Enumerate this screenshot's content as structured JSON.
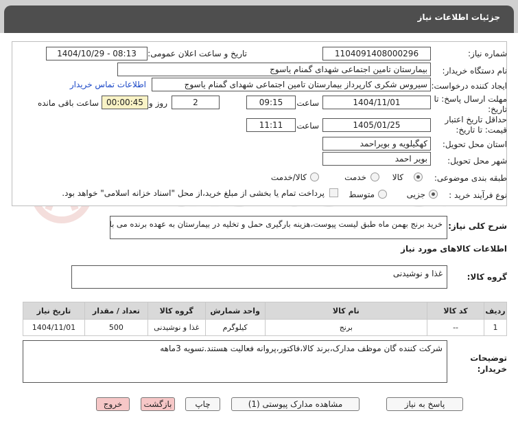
{
  "header": {
    "title": "جزئیات اطلاعات نیاز"
  },
  "form": {
    "need_number_label": "شماره نیاز:",
    "need_number": "1104091408000296",
    "announce_label": "تاریخ و ساعت اعلان عمومی:",
    "announce_value": "1404/10/29 - 08:13",
    "buyer_org_label": "نام دستگاه خریدار:",
    "buyer_org": "بیمارستان تامین اجتماعی شهدای گمنام یاسوج",
    "creator_label": "ایجاد کننده درخواست:",
    "creator": "سیروس شکری کارپرداز بیمارستان تامین اجتماعی شهدای گمنام یاسوج",
    "contact_link": "اطلاعات تماس خریدار",
    "deadline_label_1": "مهلت ارسال پاسخ: تا",
    "deadline_label_2": "تاریخ:",
    "deadline_date": "1404/11/01",
    "time_label": "ساعت",
    "deadline_time": "09:15",
    "days_value": "2",
    "days_label": "روز و",
    "remaining_time": "00:00:45",
    "remaining_label": "ساعت باقی مانده",
    "validity_label_1": "حداقل تاریخ اعتبار",
    "validity_label_2": "قیمت: تا تاریخ:",
    "validity_date": "1405/01/25",
    "validity_time_label": "ساعت",
    "validity_time": "11:11",
    "province_label": "استان محل تحویل:",
    "province": "کهگیلویه و بویراحمد",
    "city_label": "شهر محل تحویل:",
    "city": "بویر احمد",
    "category_label": "طبقه بندی موضوعی:",
    "category_options": [
      "کالا",
      "خدمت",
      "کالا/خدمت"
    ],
    "process_label": "نوع فرآیند خرید :",
    "process_options": [
      "جزیی",
      "متوسط"
    ],
    "payment_note": "پرداخت تمام یا بخشی از مبلغ خرید،از محل \"اسناد خزانه اسلامی\" خواهد بود."
  },
  "description": {
    "label": "شرح کلی نیاز:",
    "text": "خرید برنج بهمن ماه طبق لیست پیوست،هزینه بارگیری حمل و تخلیه در بیمارستان به عهده برنده می باشد"
  },
  "goods": {
    "section_title": "اطلاعات کالاهای مورد نیاز",
    "group_label": "گروه کالا:",
    "group_value": "غذا و نوشیدنی",
    "columns": [
      "ردیف",
      "کد کالا",
      "نام کالا",
      "واحد شمارش",
      "گروه کالا",
      "تعداد / مقدار",
      "تاریخ نیاز"
    ],
    "rows": [
      [
        "1",
        "--",
        "برنج",
        "کیلوگرم",
        "غذا و نوشیدنی",
        "500",
        "1404/11/01"
      ]
    ]
  },
  "buyer_notes": {
    "label_1": "توضیحات",
    "label_2": "خریدار:",
    "text": "شرکت کننده گان موظف مدارک،برند کالا،فاکتور،پروانه فعالیت هستند.تسویه 3ماهه"
  },
  "buttons": {
    "reply": "پاسخ به نیاز",
    "attachments": "مشاهده مدارک پیوستی (1)",
    "print": "چاپ",
    "back": "بازگشت",
    "exit": "خروج"
  },
  "watermark": {
    "text": "AriaTender.neT"
  },
  "colors": {
    "header_bg": "#4e4e4e",
    "link": "#1a47c7",
    "timer_bg": "#f9f3c6",
    "pink_button": "#f6c7c7"
  }
}
